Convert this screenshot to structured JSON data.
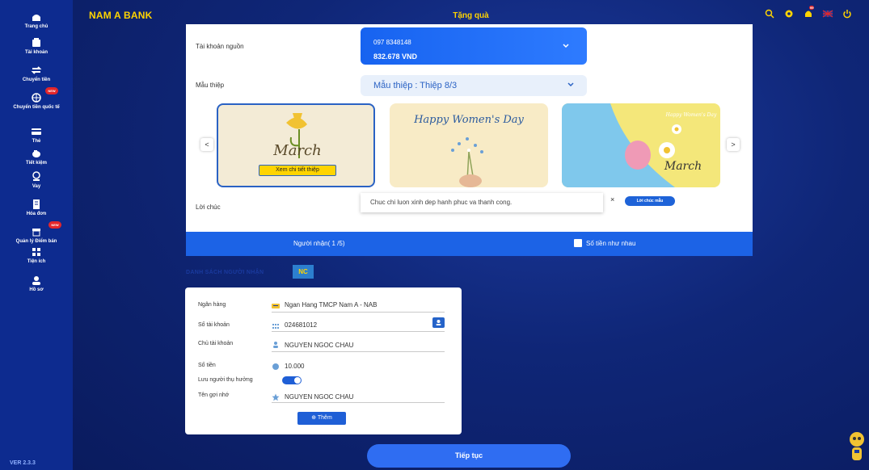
{
  "sidebar": {
    "items": [
      {
        "label": "Trang chủ",
        "icon": "home-icon"
      },
      {
        "label": "Tài khoản",
        "icon": "wallet-icon"
      },
      {
        "label": "Chuyển tiền",
        "icon": "transfer-icon",
        "badge": "NEW"
      },
      {
        "label": "Chuyển tiền quốc tế",
        "icon": "globe-icon"
      },
      {
        "label": "Thẻ",
        "icon": "card-icon"
      },
      {
        "label": "Tiết kiệm",
        "icon": "piggy-bank-icon"
      },
      {
        "label": "Vay",
        "icon": "loan-icon"
      },
      {
        "label": "Hóa đơn",
        "icon": "bill-icon"
      },
      {
        "label": "Quản lý Điểm bán",
        "icon": "store-icon",
        "badge": "NEW"
      },
      {
        "label": "Tiện ích",
        "icon": "grid-icon"
      },
      {
        "label": "Hồ sơ",
        "icon": "profile-icon"
      }
    ],
    "version": "VER 2.3.3"
  },
  "header": {
    "brand": "NAM A BANK",
    "title": "Tặng quà",
    "icons": [
      "search-icon",
      "settings-icon",
      "notification-icon",
      "flag-icon",
      "power-icon"
    ],
    "notification_count": "99"
  },
  "form": {
    "source_label": "Tài khoản nguồn",
    "account_number": "097 8348148",
    "account_balance": "832.678 VND",
    "template_label": "Mẫu thiệp",
    "template_value": "Mẫu thiệp : Thiệp 8/3",
    "card_detail_label": "Xem chi tiết thiệp",
    "card_texts": [
      "March",
      "Happy Women's Day",
      "Happy Women's Day",
      "March"
    ],
    "wish_label": "Lời chúc",
    "wish_value": "Chuc chi luon xinh dep hanh phuc va thanh cong.",
    "wish_clear": "×",
    "wish_sample_label": "Lời chúc mẫu",
    "prev_arrow": "<",
    "next_arrow": ">"
  },
  "recipients": {
    "title": "Người nhận( 1 /5)",
    "same_amount_label": "Số tiền như nhau",
    "list_label": "DANH SÁCH NGƯỜI NHẬN",
    "tab_label": "NC"
  },
  "recipient_card": {
    "bank_label": "Ngân hàng",
    "bank_value": "Ngan Hang TMCP Nam A - NAB",
    "account_label": "Số tài khoản",
    "account_value": "024681012",
    "holder_label": "Chủ tài khoản",
    "holder_value": "NGUYEN NGOC CHAU",
    "amount_label": "Số tiền",
    "amount_value": "10.000",
    "save_label": "Lưu người thụ hưởng",
    "save_enabled": true,
    "nickname_label": "Tên gợi nhớ",
    "nickname_value": "NGUYEN NGOC CHAU",
    "add_label": "⊕ Thêm"
  },
  "actions": {
    "continue_label": "Tiếp tục"
  },
  "colors": {
    "brand_yellow": "#ffd400",
    "primary_blue": "#1c63e6",
    "sidebar": "#0d2b8f",
    "badge_red": "#e3262b"
  }
}
